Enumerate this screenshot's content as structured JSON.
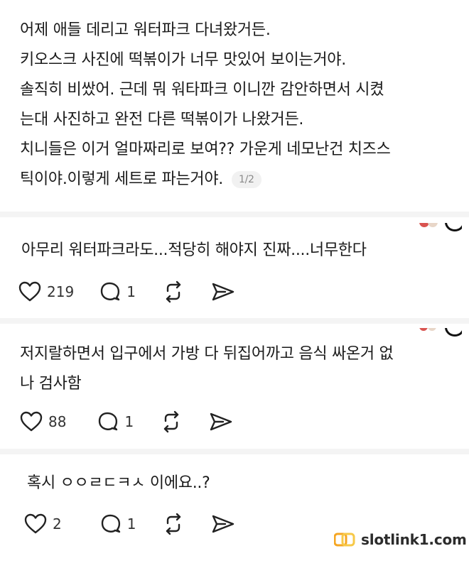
{
  "post": {
    "lines": [
      "어제 애들 데리고 워터파크 다녀왔거든.",
      "키오스크 사진에 떡볶이가 너무 맛있어 보이는거야.",
      "솔직히 비쌌어. 근데 뭐 워타파크 이니깐 감안하면서 시켰",
      "는대 사진하고 완전 다른 떡볶이가 나왔거든.",
      "치니들은 이거 얼마짜리로 보여?? 가운게 네모난건 치즈스",
      "틱이야.이렇게 세트로 파는거야."
    ],
    "page_badge": "1/2"
  },
  "replies": [
    {
      "text_lines": [
        "아무리 워터파크라도...적당히 해야지 진짜....너무한다"
      ],
      "likes": "219",
      "comments": "1"
    },
    {
      "text_lines": [
        "저지랄하면서 입구에서 가방 다 뒤집어까고 음식 싸온거 없",
        "나 검사함"
      ],
      "likes": "88",
      "comments": "1"
    },
    {
      "text_lines": [
        "혹시 ㅇㅇㄹㄷㅋㅅ 이에요..?"
      ],
      "likes": "2",
      "comments": "1"
    }
  ],
  "icons": {
    "like": "heart-icon",
    "comment": "comment-bubble-icon",
    "repost": "repost-icon",
    "share": "send-icon"
  },
  "watermark": {
    "text": "slotlink1.com"
  },
  "colors": {
    "divider": "#f4f4f4",
    "text": "#1a1a1a",
    "watermark_logo": "#f5a623"
  }
}
